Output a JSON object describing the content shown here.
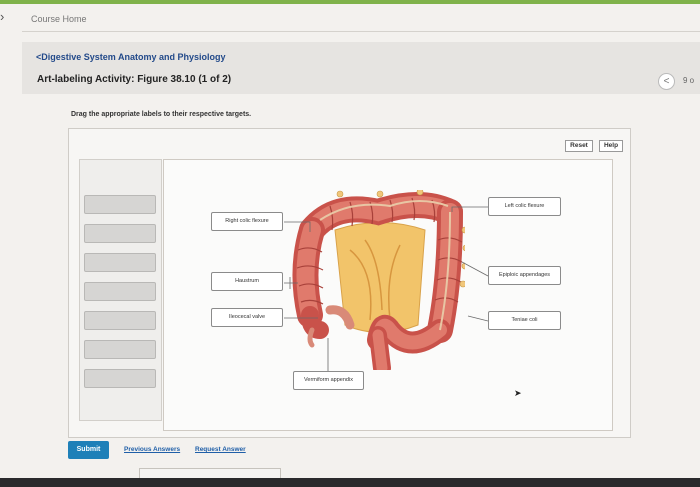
{
  "nav": {
    "back_glyph": "›",
    "course_home": "Course Home"
  },
  "header": {
    "breadcrumb": "<Digestive System Anatomy and Physiology",
    "title": "Art-labeling Activity: Figure 38.10 (1 of 2)",
    "prev_glyph": "<",
    "page_count": "9 o"
  },
  "activity": {
    "instruction": "Drag the appropriate labels to their respective targets.",
    "reset_label": "Reset",
    "help_label": "Help",
    "bank_slot_count": 7,
    "targets": [
      {
        "id": "right-colic",
        "text": "Right colic flexure"
      },
      {
        "id": "haustrum",
        "text": "Haustrum"
      },
      {
        "id": "ileocecal",
        "text": "Ileocecal valve"
      },
      {
        "id": "vermiform",
        "text": "Vermiform appendix"
      },
      {
        "id": "left-colic",
        "text": "Left colic flexure"
      },
      {
        "id": "epiploic",
        "text": "Epiploic appendages"
      },
      {
        "id": "teniae",
        "text": "Teniae coli"
      }
    ]
  },
  "footer": {
    "submit_label": "Submit",
    "previous_answers": "Previous Answers",
    "request_answer": "Request Answer"
  },
  "colors": {
    "accent_green": "#7fb24a",
    "submit_blue": "#1e80b8",
    "link_blue": "#1f5fa8",
    "colon": "#d9665c"
  }
}
